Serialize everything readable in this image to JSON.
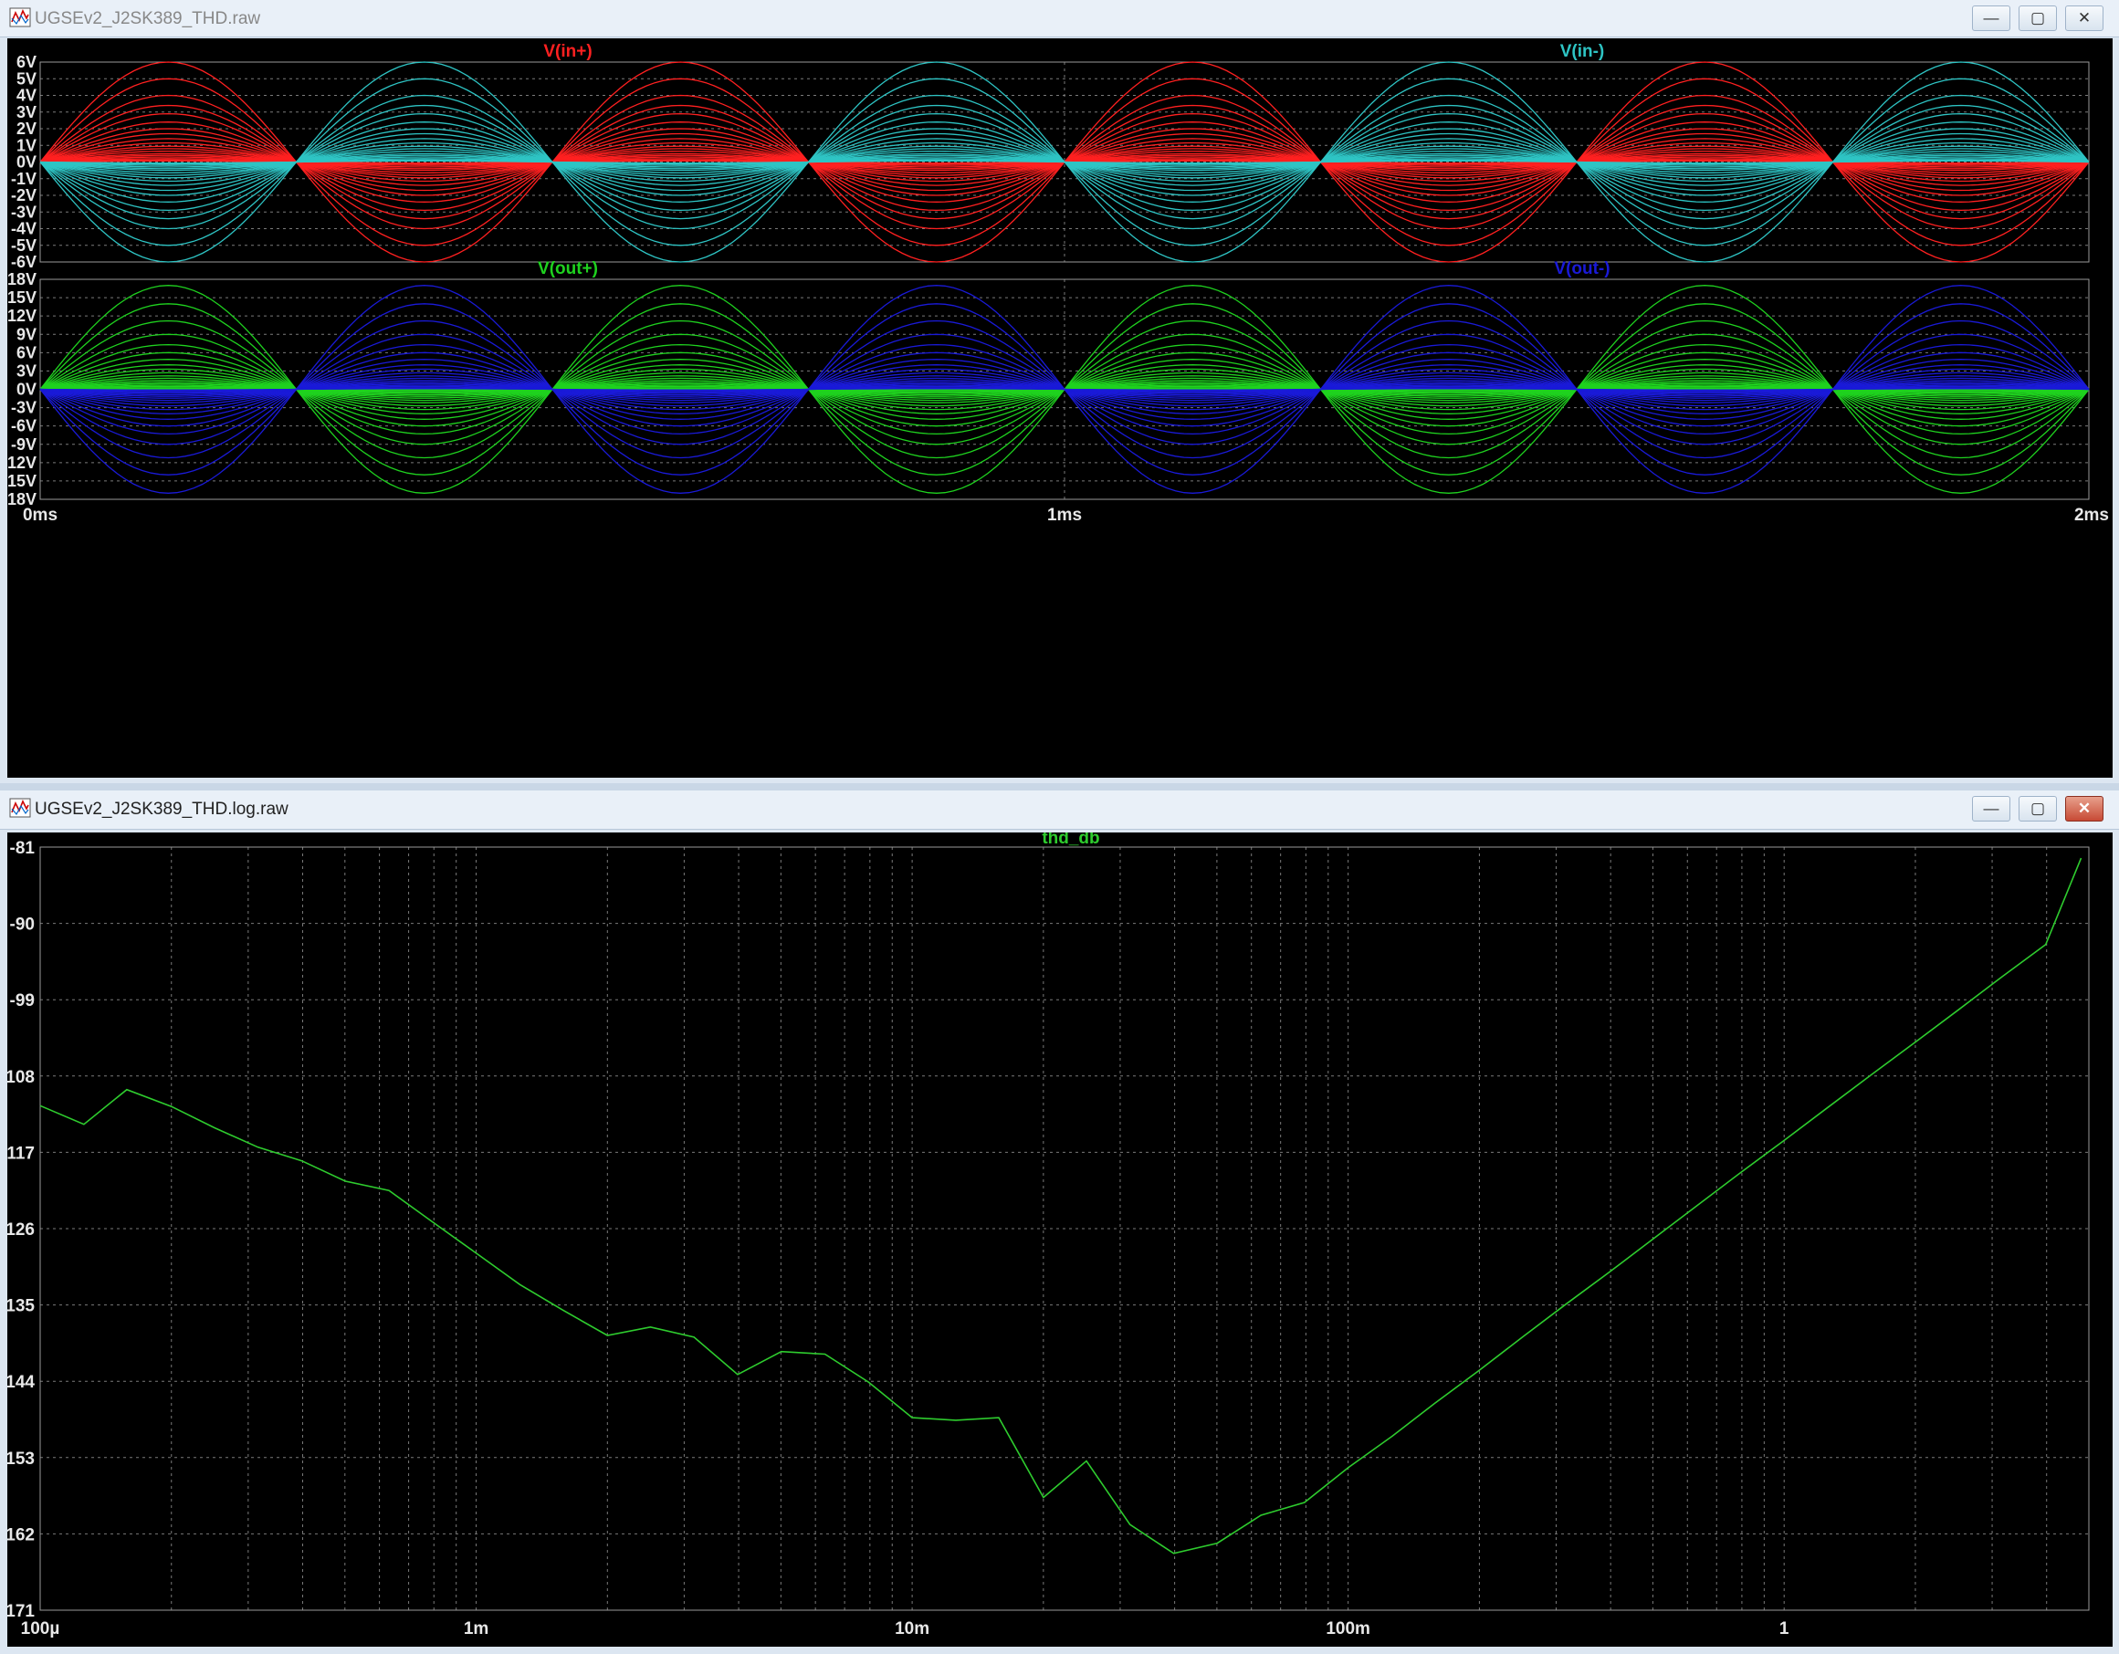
{
  "windows": {
    "top": {
      "title": "UGSEv2_J2SK389_THD.raw",
      "minimize": "—",
      "maximize": "▢",
      "close": "✕"
    },
    "bottom": {
      "title": "UGSEv2_J2SK389_THD.log.raw",
      "minimize": "—",
      "maximize": "▢",
      "close": "✕"
    }
  },
  "icons": {
    "app": "waveform-app-icon",
    "minimize": "minimize-icon",
    "maximize": "maximize-icon",
    "close": "close-icon"
  },
  "colors": {
    "plot_bg": "#000000",
    "grid": "#7a7a7a",
    "axis_text": "#e8e8e8",
    "vin_plus": "#ff2020",
    "vin_minus": "#2ec4c4",
    "vout_plus": "#1fd21f",
    "vout_minus": "#1a1ad8",
    "thd": "#2ecc2e"
  },
  "chart_data": [
    {
      "type": "line",
      "xlim": [
        0,
        2
      ],
      "x_ticks": [
        "0ms",
        "1ms",
        "2ms"
      ],
      "x_tick_values": [
        0,
        1,
        2
      ],
      "xlabel": "",
      "ylabel": "",
      "ylim": [
        -6,
        6
      ],
      "y_ticks": [
        "6V",
        "5V",
        "4V",
        "3V",
        "2V",
        "1V",
        "0V",
        "-1V",
        "-2V",
        "-3V",
        "-4V",
        "-5V",
        "-6V"
      ],
      "y_tick_values": [
        6,
        5,
        4,
        3,
        2,
        1,
        0,
        -1,
        -2,
        -3,
        -4,
        -5,
        -6
      ],
      "grid": true,
      "legend": [
        "V(in+)",
        "V(in-)"
      ],
      "waveform": "sine 2 kHz (period 0.5 ms), stepped amplitude family",
      "amplitudes": [
        6,
        5,
        4,
        3.4,
        2.9,
        2.4,
        2.0,
        1.7,
        1.4,
        1.15,
        0.95,
        0.8,
        0.65,
        0.5,
        0.4,
        0.3,
        0.2,
        0.12,
        0.06
      ],
      "series": [
        {
          "name": "V(in+)",
          "sign": 1
        },
        {
          "name": "V(in-)",
          "sign": -1
        }
      ]
    },
    {
      "type": "line",
      "xlim": [
        0,
        2
      ],
      "x_tick_values": [
        0,
        1,
        2
      ],
      "xlabel": "",
      "ylabel": "",
      "ylim": [
        -18,
        18
      ],
      "y_ticks": [
        "18V",
        "15V",
        "12V",
        "9V",
        "6V",
        "3V",
        "0V",
        "-3V",
        "-6V",
        "-9V",
        "-12V",
        "-15V",
        "-18V"
      ],
      "y_tick_values": [
        18,
        15,
        12,
        9,
        6,
        3,
        0,
        -3,
        -6,
        -9,
        -12,
        -15,
        -18
      ],
      "grid": true,
      "legend": [
        "V(out+)",
        "V(out-)"
      ],
      "waveform": "sine 2 kHz (period 0.5 ms), stepped amplitude family",
      "amplitudes": [
        17,
        14,
        11.2,
        9,
        7.3,
        6,
        4.9,
        4,
        3.3,
        2.7,
        2.2,
        1.8,
        1.45,
        1.15,
        0.9,
        0.65,
        0.45,
        0.25,
        0.1
      ],
      "series": [
        {
          "name": "V(out+)",
          "sign": 1
        },
        {
          "name": "V(out-)",
          "sign": -1
        }
      ]
    },
    {
      "type": "line",
      "x_scale": "log",
      "xlim": [
        0.0001,
        5
      ],
      "x_ticks": [
        "100µ",
        "1m",
        "10m",
        "100m",
        "1"
      ],
      "x_tick_values": [
        0.0001,
        0.001,
        0.01,
        0.1,
        1
      ],
      "xlabel": "",
      "ylabel": "",
      "ylim": [
        -171,
        -81
      ],
      "y_ticks": [
        "-81",
        "-90",
        "-99",
        "-108",
        "-117",
        "-126",
        "-135",
        "-144",
        "-153",
        "-162",
        "-171"
      ],
      "y_tick_values": [
        -81,
        -90,
        -99,
        -108,
        -117,
        -126,
        -135,
        -144,
        -153,
        -162,
        -171
      ],
      "grid": true,
      "legend": [
        "thd_db"
      ],
      "series": [
        {
          "name": "thd_db",
          "x": [
            0.0001,
            0.000126,
            0.000158,
            0.0002,
            0.000251,
            0.000316,
            0.000398,
            0.000501,
            0.000631,
            0.000794,
            0.001,
            0.00126,
            0.00158,
            0.002,
            0.00251,
            0.00316,
            0.00398,
            0.00501,
            0.00631,
            0.00794,
            0.01,
            0.0126,
            0.0158,
            0.02,
            0.0251,
            0.0316,
            0.0398,
            0.0501,
            0.0631,
            0.0794,
            0.1,
            0.126,
            0.158,
            0.2,
            0.251,
            0.316,
            0.398,
            0.501,
            0.631,
            0.794,
            1,
            1.26,
            1.58,
            2,
            2.51,
            3.16,
            3.98,
            4.8
          ],
          "y": [
            -111.5,
            -113.7,
            -109.6,
            -111.6,
            -114.1,
            -116.4,
            -118,
            -120.4,
            -121.5,
            -125.2,
            -128.9,
            -132.6,
            -135.6,
            -138.6,
            -137.6,
            -138.8,
            -143.2,
            -140.5,
            -140.8,
            -144.1,
            -148.3,
            -148.6,
            -148.3,
            -157.7,
            -153.4,
            -160.9,
            -164.3,
            -163.1,
            -159.8,
            -158.3,
            -154.2,
            -150.5,
            -146.6,
            -142.7,
            -138.8,
            -134.9,
            -131.1,
            -127.2,
            -123.3,
            -119.4,
            -115.6,
            -111.7,
            -107.9,
            -104,
            -100.2,
            -96.3,
            -92.5,
            -82.3
          ]
        }
      ]
    }
  ]
}
